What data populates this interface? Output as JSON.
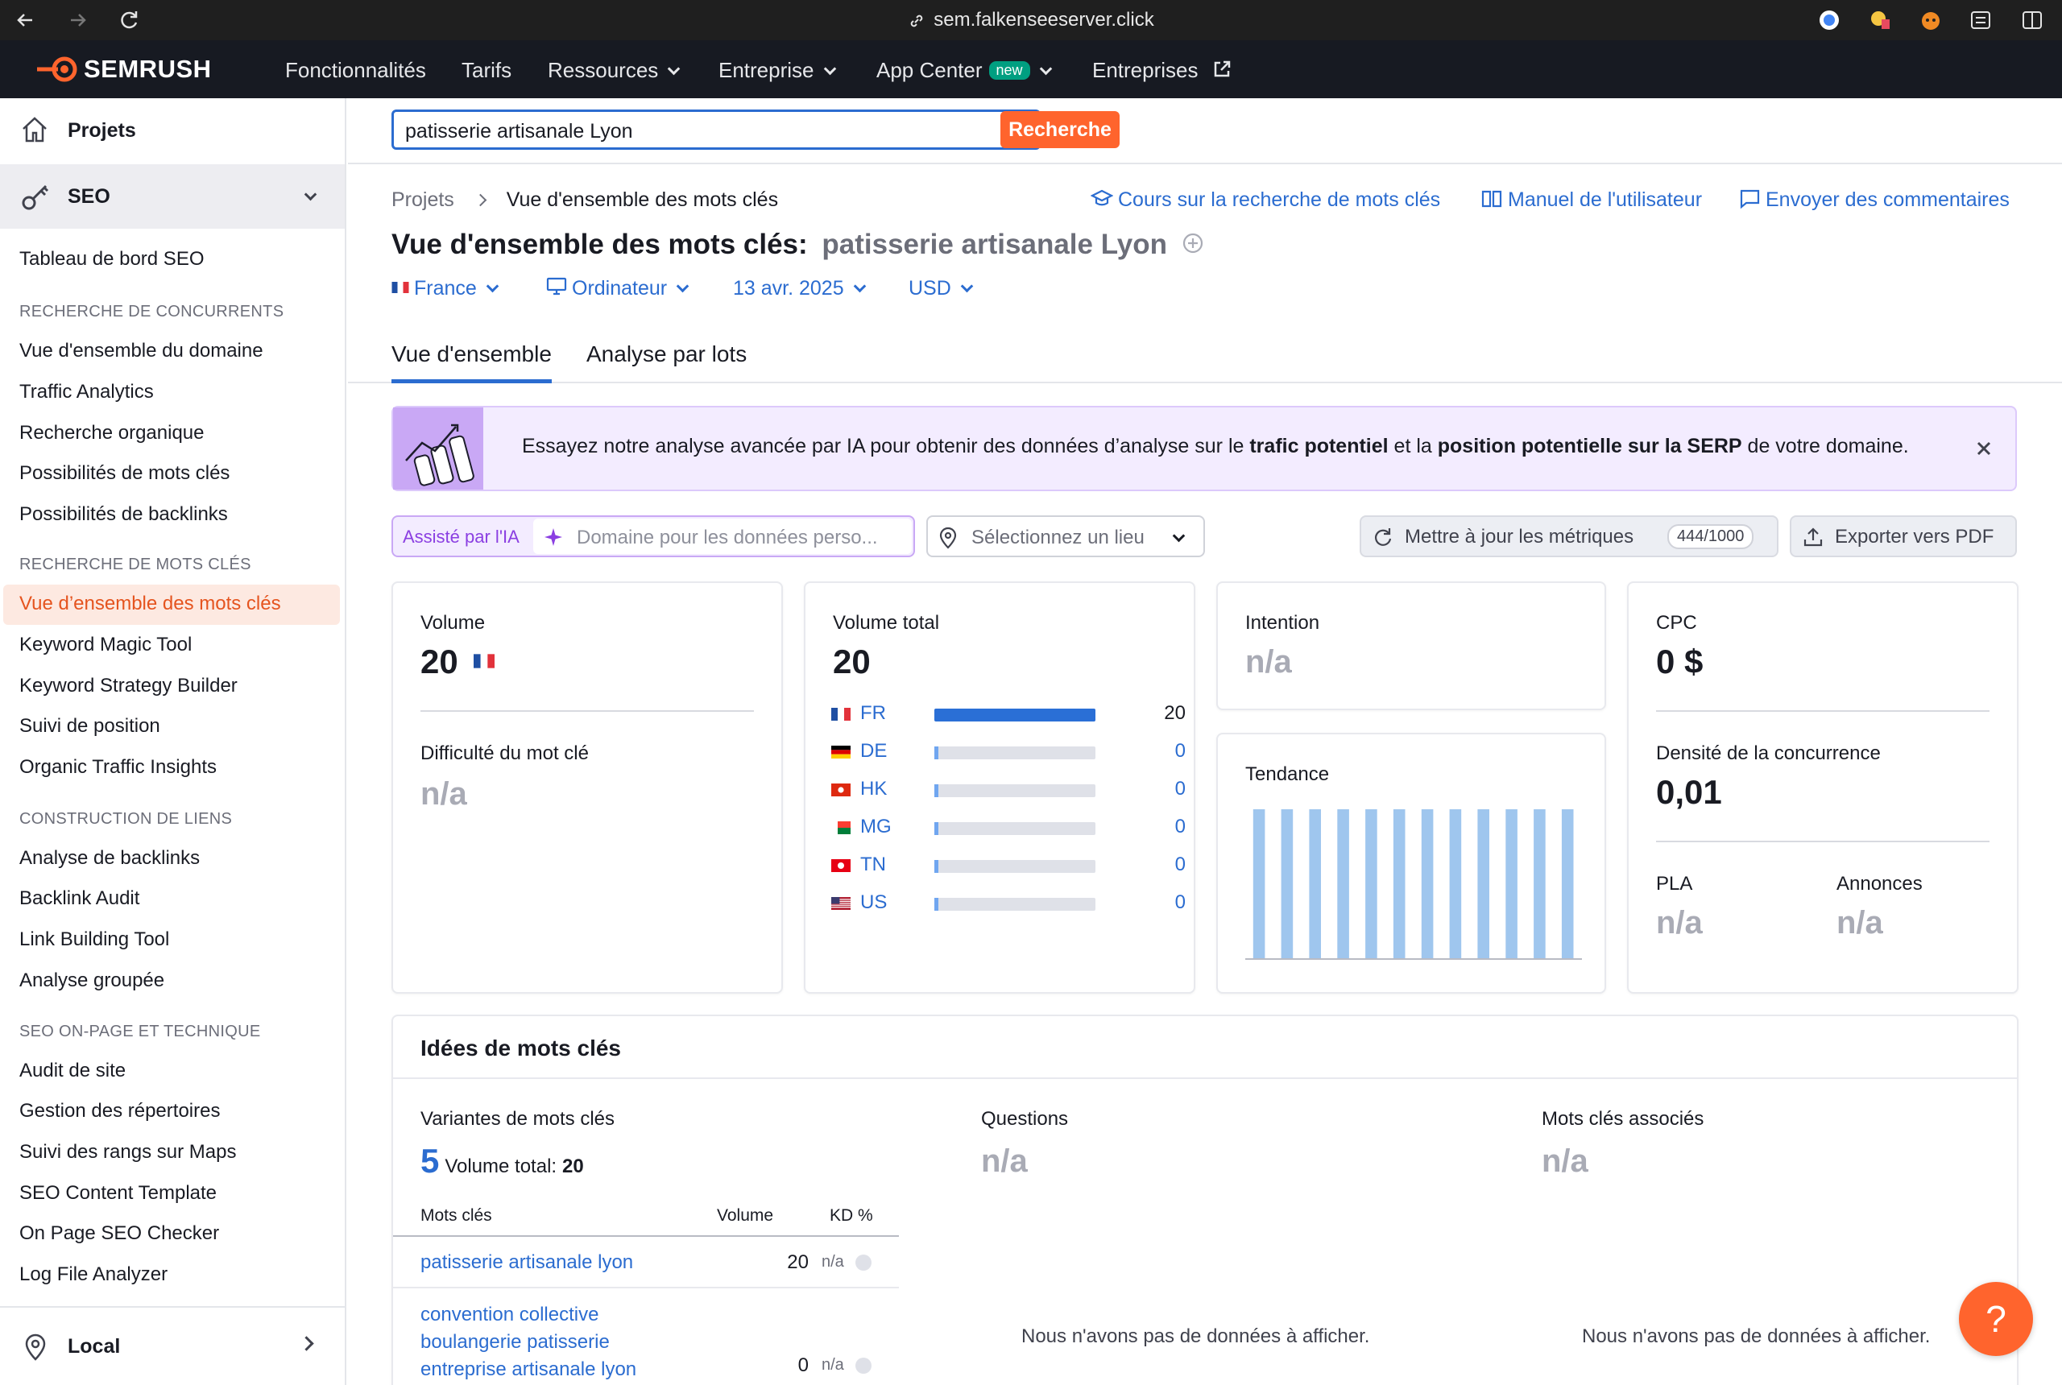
{
  "browser": {
    "url": "sem.falkenseeserver.click"
  },
  "nav": {
    "logo": "SEMRUSH",
    "items": [
      {
        "label": "Fonctionnalités"
      },
      {
        "label": "Tarifs"
      },
      {
        "label": "Ressources"
      },
      {
        "label": "Entreprise"
      },
      {
        "label": "App Center",
        "badge": "new"
      },
      {
        "label": "Entreprises"
      }
    ]
  },
  "sidebar": {
    "projects": "Projets",
    "seo": "SEO",
    "dashboard": "Tableau de bord SEO",
    "sections": [
      {
        "title": "RECHERCHE DE CONCURRENTS",
        "items": [
          "Vue d'ensemble du domaine",
          "Traffic Analytics",
          "Recherche organique",
          "Possibilités de mots clés",
          "Possibilités de backlinks"
        ]
      },
      {
        "title": "RECHERCHE DE MOTS CLÉS",
        "items": [
          "Vue d’ensemble des mots clés",
          "Keyword Magic Tool",
          "Keyword Strategy Builder",
          "Suivi de position",
          "Organic Traffic Insights"
        ]
      },
      {
        "title": "CONSTRUCTION DE LIENS",
        "items": [
          "Analyse de backlinks",
          "Backlink Audit",
          "Link Building Tool",
          "Analyse groupée"
        ]
      },
      {
        "title": "SEO ON-PAGE ET TECHNIQUE",
        "items": [
          "Audit de site",
          "Gestion des répertoires",
          "Suivi des rangs sur Maps",
          "SEO Content Template",
          "On Page SEO Checker",
          "Log File Analyzer"
        ]
      }
    ],
    "local": "Local"
  },
  "search": {
    "value": "patisserie artisanale Lyon",
    "button": "Recherche"
  },
  "breadcrumb": {
    "root": "Projets",
    "current": "Vue d'ensemble des mots clés"
  },
  "help_links": {
    "course": "Cours sur la recherche de mots clés",
    "manual": "Manuel de l'utilisateur",
    "feedback": "Envoyer des commentaires"
  },
  "title": {
    "prefix": "Vue d'ensemble des mots clés:",
    "keyword": "patisserie artisanale Lyon"
  },
  "filters": {
    "country": "France",
    "device": "Ordinateur",
    "date": "13 avr. 2025",
    "currency": "USD"
  },
  "tabs": [
    "Vue d'ensemble",
    "Analyse par lots"
  ],
  "banner": {
    "t1": "Essayez notre analyse avancée par IA pour obtenir des données d’analyse sur le ",
    "b1": "trafic potentiel",
    "t2": " et la ",
    "b2": "position potentielle sur la SERP",
    "t3": " de votre domaine."
  },
  "toolbar": {
    "ai_label": "Assisté par l'IA",
    "domain_placeholder": "Domaine pour les données perso...",
    "location_placeholder": "Sélectionnez un lieu",
    "update": "Mettre à jour les métriques",
    "update_count": "444/1000",
    "export": "Exporter vers PDF"
  },
  "metrics": {
    "volume_label": "Volume",
    "volume": "20",
    "kd_label": "Difficulté du mot clé",
    "kd": "n/a",
    "total_label": "Volume total",
    "total": "20",
    "countries": [
      {
        "code": "FR",
        "value": "20",
        "share": 1
      },
      {
        "code": "DE",
        "value": "0",
        "share": 0
      },
      {
        "code": "HK",
        "value": "0",
        "share": 0
      },
      {
        "code": "MG",
        "value": "0",
        "share": 0
      },
      {
        "code": "TN",
        "value": "0",
        "share": 0
      },
      {
        "code": "US",
        "value": "0",
        "share": 0
      }
    ],
    "intent_label": "Intention",
    "intent": "n/a",
    "trend_label": "Tendance",
    "trend": [
      1,
      1,
      1,
      1,
      1,
      1,
      1,
      1,
      1,
      1,
      1,
      1
    ],
    "cpc_label": "CPC",
    "cpc": "0 $",
    "density_label": "Densité de la concurrence",
    "density": "0,01",
    "pla_label": "PLA",
    "pla": "n/a",
    "ads_label": "Annonces",
    "ads": "n/a"
  },
  "ideas": {
    "title": "Idées de mots clés",
    "variants_label": "Variantes de mots clés",
    "variants_count": "5",
    "variants_total_label": "Volume total:",
    "variants_total": "20",
    "questions_label": "Questions",
    "questions": "n/a",
    "related_label": "Mots clés associés",
    "related": "n/a",
    "no_data": "Nous n'avons pas de données à afficher.",
    "columns": [
      "Mots clés",
      "Volume",
      "KD %"
    ],
    "rows": [
      {
        "keyword": "patisserie artisanale lyon",
        "volume": "20",
        "kd": "n/a"
      },
      {
        "keyword": "convention collective boulangerie patisserie entreprise artisanale lyon",
        "volume": "0",
        "kd": "n/a"
      }
    ]
  },
  "help_button": "?"
}
